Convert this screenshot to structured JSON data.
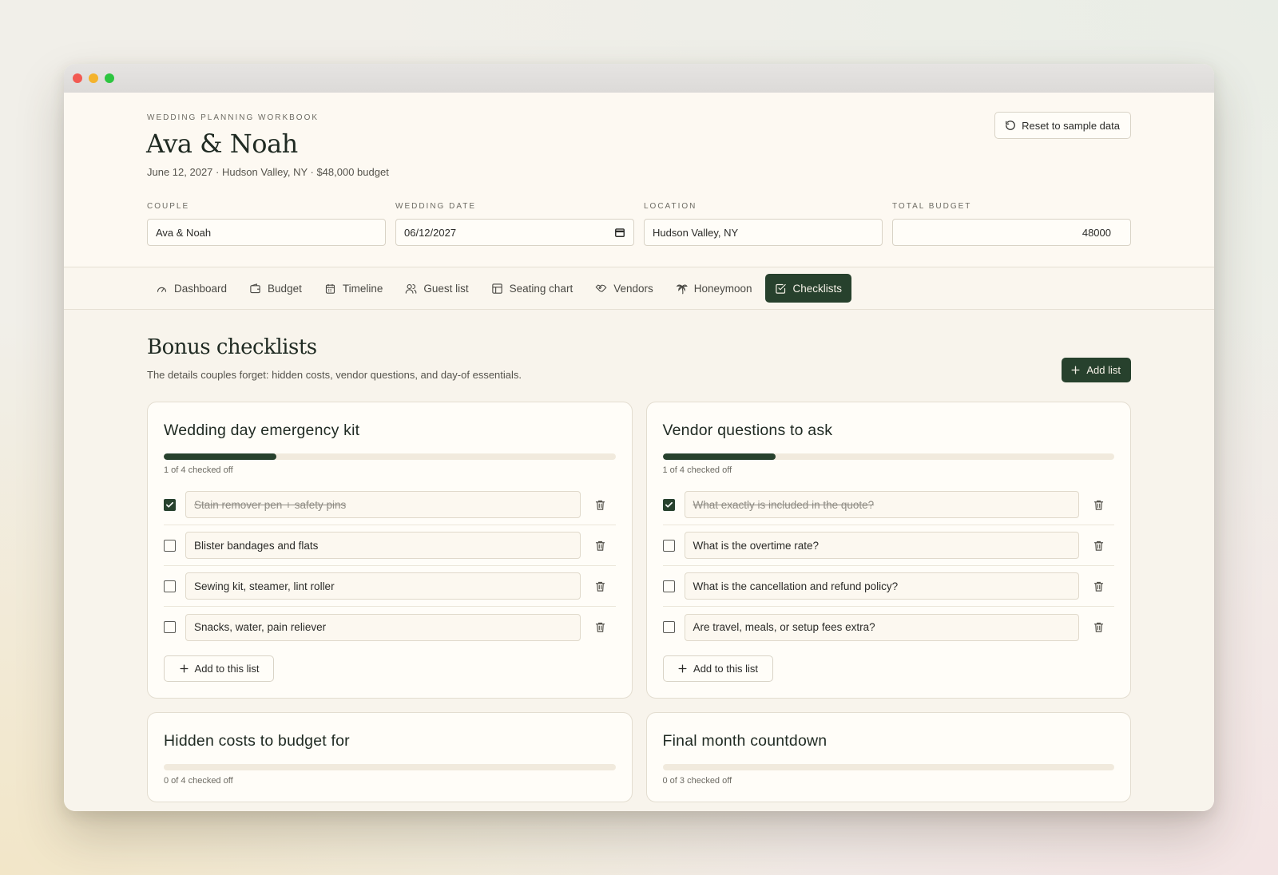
{
  "header": {
    "eyebrow": "WEDDING PLANNING WORKBOOK",
    "title": "Ava & Noah",
    "subtitle": "June 12, 2027 · Hudson Valley, NY · $48,000 budget",
    "reset_label": "Reset to sample data"
  },
  "fields": {
    "couple": {
      "label": "COUPLE",
      "value": "Ava & Noah"
    },
    "date": {
      "label": "WEDDING DATE",
      "value": "06/12/2027"
    },
    "location": {
      "label": "LOCATION",
      "value": "Hudson Valley, NY"
    },
    "budget": {
      "label": "TOTAL BUDGET",
      "value": "48000"
    }
  },
  "tabs": [
    {
      "label": "Dashboard",
      "icon": "gauge-icon"
    },
    {
      "label": "Budget",
      "icon": "wallet-icon"
    },
    {
      "label": "Timeline",
      "icon": "calendar-icon"
    },
    {
      "label": "Guest list",
      "icon": "users-icon"
    },
    {
      "label": "Seating chart",
      "icon": "table-icon"
    },
    {
      "label": "Vendors",
      "icon": "handshake-icon"
    },
    {
      "label": "Honeymoon",
      "icon": "palm-tree-icon"
    },
    {
      "label": "Checklists",
      "icon": "checkbox-icon",
      "active": true
    }
  ],
  "section": {
    "title": "Bonus checklists",
    "subtitle": "The details couples forget: hidden costs, vendor questions, and day-of essentials.",
    "add_list_label": "Add list"
  },
  "colors": {
    "accent": "#27412d",
    "background": "#f8f4ec"
  },
  "cards": [
    {
      "title": "Wedding day emergency kit",
      "progress": 0.25,
      "progress_text": "1 of 4 checked off",
      "items": [
        {
          "text": "Stain remover pen + safety pins",
          "checked": true
        },
        {
          "text": "Blister bandages and flats",
          "checked": false
        },
        {
          "text": "Sewing kit, steamer, lint roller",
          "checked": false
        },
        {
          "text": "Snacks, water, pain reliever",
          "checked": false
        }
      ],
      "add_label": "Add to this list"
    },
    {
      "title": "Vendor questions to ask",
      "progress": 0.25,
      "progress_text": "1 of 4 checked off",
      "items": [
        {
          "text": "What exactly is included in the quote?",
          "checked": true
        },
        {
          "text": "What is the overtime rate?",
          "checked": false
        },
        {
          "text": "What is the cancellation and refund policy?",
          "checked": false
        },
        {
          "text": "Are travel, meals, or setup fees extra?",
          "checked": false
        }
      ],
      "add_label": "Add to this list"
    },
    {
      "title": "Hidden costs to budget for",
      "progress": 0,
      "progress_text": "0 of 4 checked off",
      "items": [],
      "add_label": ""
    },
    {
      "title": "Final month countdown",
      "progress": 0,
      "progress_text": "0 of 3 checked off",
      "items": [],
      "add_label": ""
    }
  ]
}
